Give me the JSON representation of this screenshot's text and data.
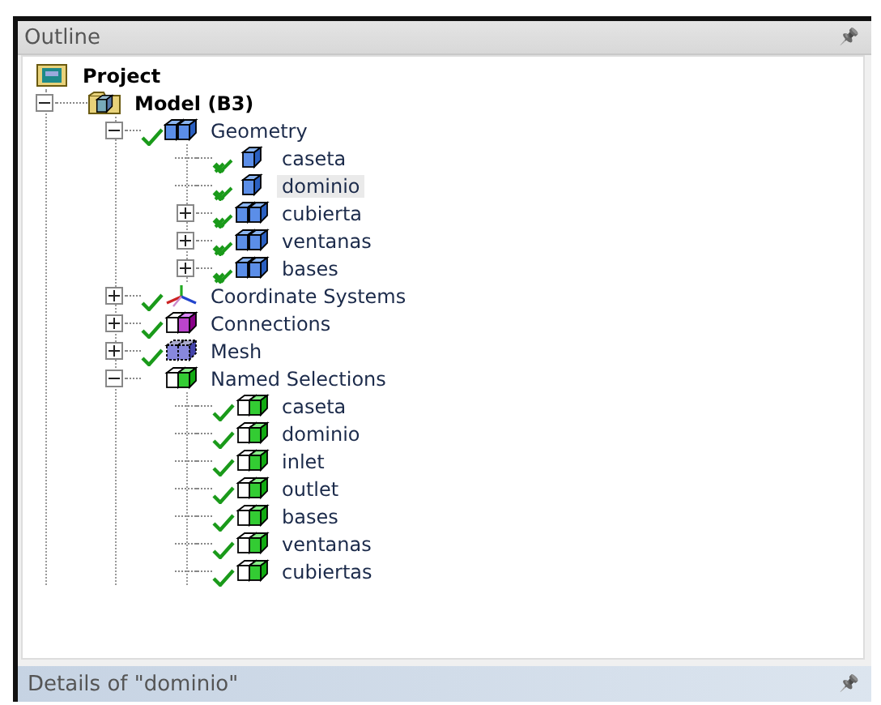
{
  "panel": {
    "title": "Outline",
    "pin": "📌"
  },
  "tree": [
    {
      "label": "Project",
      "kind": "project",
      "selected": false,
      "children": [
        {
          "label": "Model (B3)",
          "kind": "model",
          "expanded": true,
          "selected": false,
          "children": [
            {
              "label": "Geometry",
              "kind": "geometry",
              "ok": true,
              "hidden": false,
              "expanded": true,
              "selected": false,
              "children": [
                {
                  "label": "caseta",
                  "kind": "body",
                  "ok": true,
                  "hidden": true,
                  "selected": false
                },
                {
                  "label": "dominio",
                  "kind": "body",
                  "ok": true,
                  "hidden": true,
                  "selected": true
                },
                {
                  "label": "cubierta",
                  "kind": "parts",
                  "ok": true,
                  "hidden": true,
                  "expanded": false,
                  "selected": false
                },
                {
                  "label": "ventanas",
                  "kind": "parts",
                  "ok": true,
                  "hidden": true,
                  "expanded": false,
                  "selected": false
                },
                {
                  "label": "bases",
                  "kind": "parts",
                  "ok": true,
                  "hidden": true,
                  "expanded": false,
                  "selected": false
                }
              ]
            },
            {
              "label": "Coordinate Systems",
              "kind": "axes",
              "ok": true,
              "hidden": false,
              "expanded": false,
              "selected": false
            },
            {
              "label": "Connections",
              "kind": "connections",
              "ok": true,
              "hidden": false,
              "expanded": false,
              "selected": false
            },
            {
              "label": "Mesh",
              "kind": "mesh",
              "ok": true,
              "hidden": false,
              "expanded": false,
              "selected": false
            },
            {
              "label": "Named Selections",
              "kind": "named",
              "ok": false,
              "expanded": true,
              "selected": false,
              "children": [
                {
                  "label": "caseta",
                  "kind": "selection",
                  "ok": true,
                  "hidden": false,
                  "selected": false
                },
                {
                  "label": "dominio",
                  "kind": "selection",
                  "ok": true,
                  "hidden": false,
                  "selected": false
                },
                {
                  "label": "inlet",
                  "kind": "selection",
                  "ok": true,
                  "hidden": false,
                  "selected": false
                },
                {
                  "label": "outlet",
                  "kind": "selection",
                  "ok": true,
                  "hidden": false,
                  "selected": false
                },
                {
                  "label": "bases",
                  "kind": "selection",
                  "ok": true,
                  "hidden": false,
                  "selected": false
                },
                {
                  "label": "ventanas",
                  "kind": "selection",
                  "ok": true,
                  "hidden": false,
                  "selected": false
                },
                {
                  "label": "cubiertas",
                  "kind": "selection",
                  "ok": true,
                  "hidden": false,
                  "selected": false
                }
              ]
            }
          ]
        }
      ]
    }
  ],
  "details": {
    "title": "Details of \"dominio\""
  }
}
